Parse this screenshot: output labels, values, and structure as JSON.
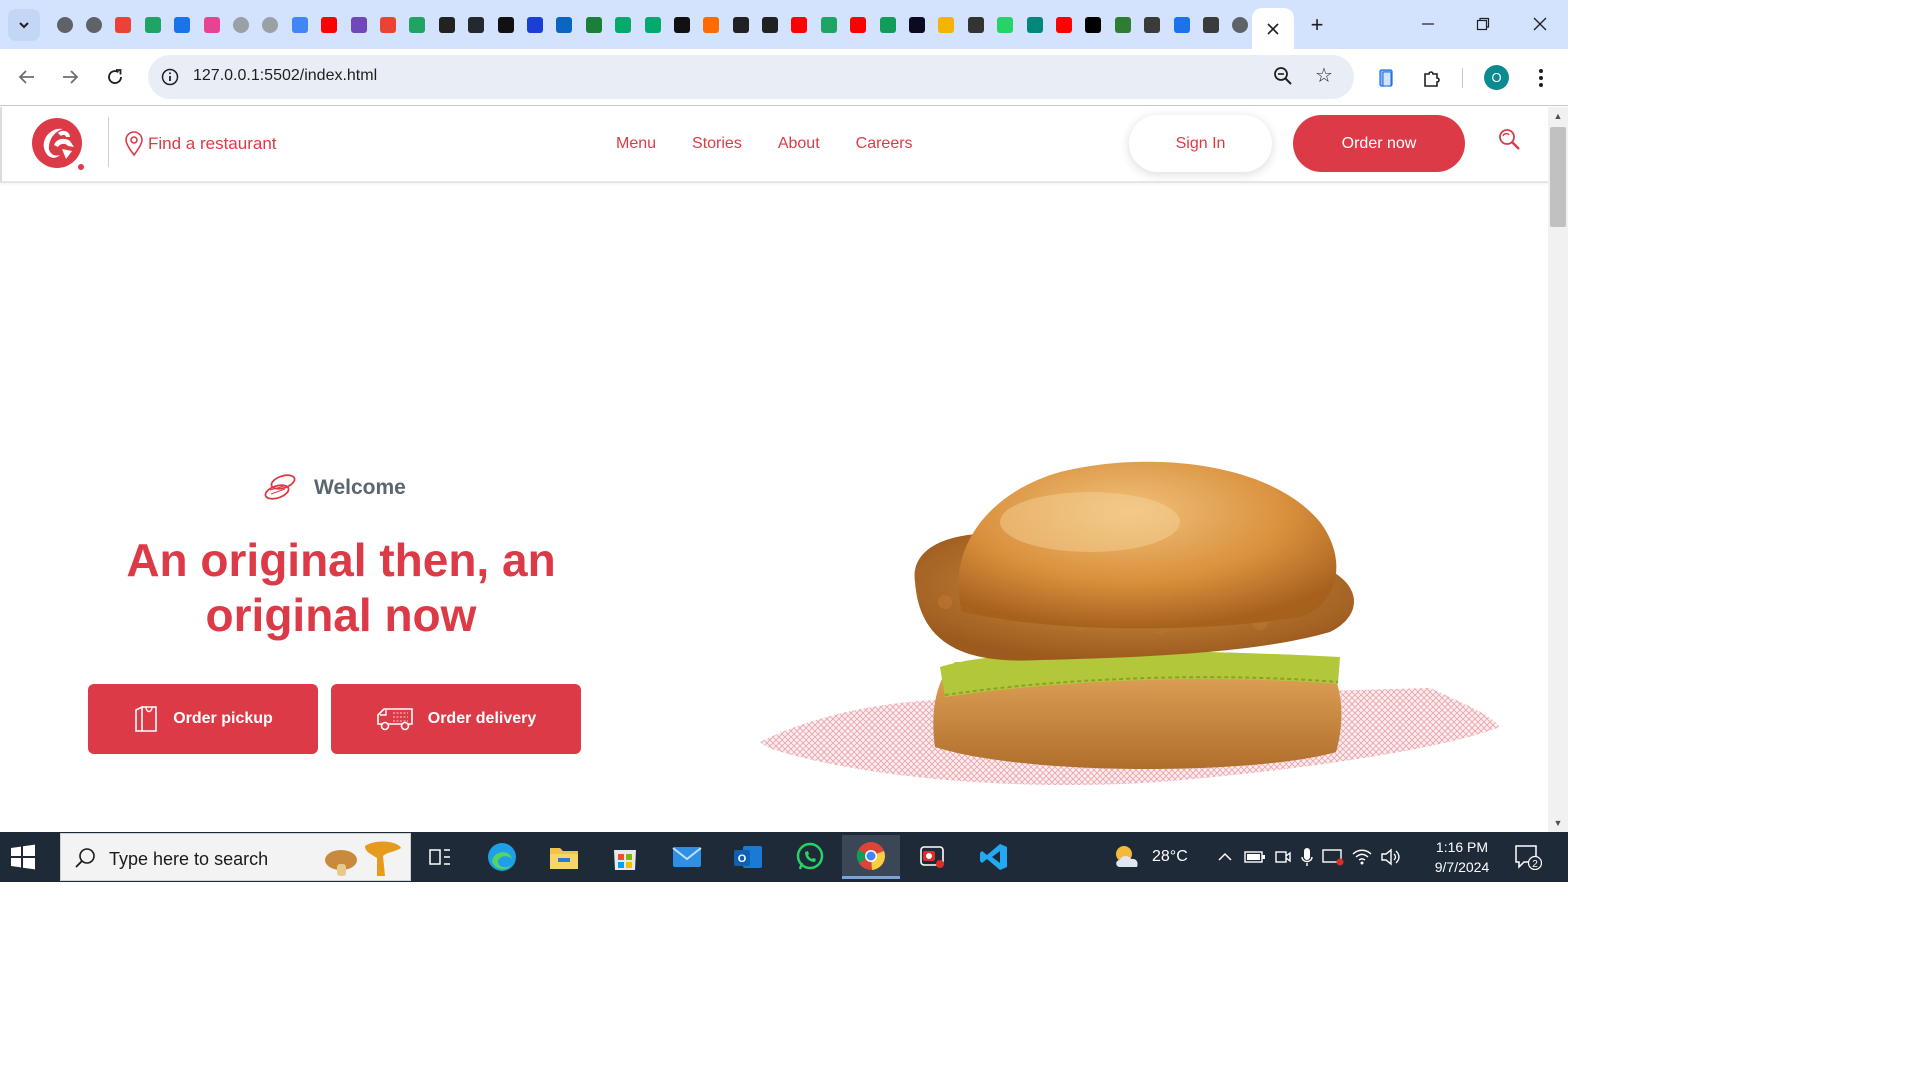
{
  "browser": {
    "url": "127.0.0.1:5502/index.html",
    "profile_initial": "O",
    "tab_favicons": [
      "globe",
      "globe",
      "gmail",
      "drive",
      "flag",
      "cube",
      "code",
      "code",
      "docs",
      "youtube",
      "forms",
      "gmail",
      "drive",
      "B",
      "github",
      "A",
      "dot",
      "linkedin",
      "sheets",
      "w3",
      "w3",
      "codepen",
      "puzzle",
      "chatgpt",
      "chatgpt",
      "youtube",
      "drive",
      "youtube",
      "plus",
      "fcc",
      "hat",
      "ninja",
      "whatsapp",
      "meet",
      "youtube",
      "x",
      "atom",
      "ww",
      "F",
      "ww",
      "globe"
    ]
  },
  "site": {
    "find_restaurant": "Find a restaurant",
    "nav": [
      "Menu",
      "Stories",
      "About",
      "Careers"
    ],
    "sign_in": "Sign In",
    "order_now": "Order now",
    "welcome": "Welcome",
    "hero_title": "An original then, an original now",
    "order_pickup": "Order pickup",
    "order_delivery": "Order delivery",
    "brand_color": "#dd3a47"
  },
  "taskbar": {
    "search_placeholder": "Type here to search",
    "weather": "28°C",
    "time": "1:16 PM",
    "date": "9/7/2024",
    "notifications": "2",
    "apps": [
      "task-view",
      "edge",
      "file-explorer",
      "microsoft-store",
      "mail",
      "outlook",
      "whatsapp",
      "chrome",
      "screen-recorder",
      "vscode"
    ]
  }
}
